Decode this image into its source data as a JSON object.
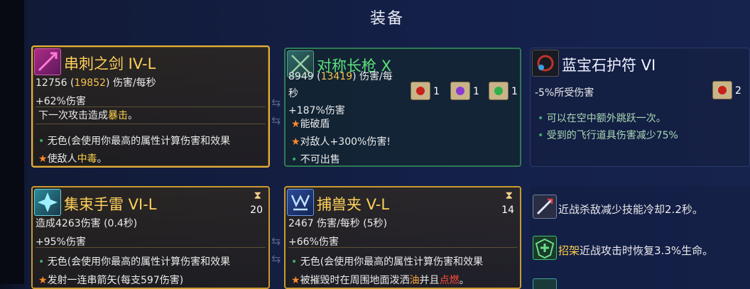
{
  "title": "装备",
  "cards": [
    {
      "name": "串刺之剑 IV-L",
      "dps": "12756",
      "dps_alt": "19852",
      "dps_unit": "伤害/每秒",
      "dmg_bonus": "+62%伤害",
      "effect_pre": "下一次攻击造成",
      "effect_hl": "暴击",
      "effect_post": "。",
      "bullet1": "无色(会使用你最高的属性计算伤害和效果",
      "bullet2_pre": "使敌人",
      "bullet2_hl": "中毒",
      "bullet2_post": "。"
    },
    {
      "name": "对称长枪 X",
      "dps": "8949",
      "dps_alt": "13419",
      "dps_unit1": "伤害/每",
      "dps_unit2": "秒",
      "dmg_bonus": "+187%伤害",
      "line1": "能破盾",
      "line2": "对敌人+300%伤害!",
      "line3": "不可出售",
      "scroll_counts": [
        "1",
        "1",
        "1"
      ]
    },
    {
      "name": "蓝宝石护符 VI",
      "line0": "-5%所受伤害",
      "scroll_count": "2",
      "line1": "可以在空中额外跳跃一次。",
      "line2": "受到的飞行道具伤害减少75%"
    },
    {
      "name": "集束手雷 VI-L",
      "cooldown": "20",
      "line0": "造成4263伤害 (0.4秒)",
      "dmg_bonus": "+95%伤害",
      "bullet1": "无色(会使用你最高的属性计算伤害和效果",
      "bullet2": "发射一连串箭矢(每支597伤害)"
    },
    {
      "name": "捕兽夹 V-L",
      "cooldown": "14",
      "line0": "2467 伤害/每秒 (5秒)",
      "dmg_bonus": "+66%伤害",
      "bullet1": "无色(会使用你最高的属性计算伤害和效果",
      "bullet2_pre": "被摧毁时在周围地面泼洒",
      "bullet2_oil": "油",
      "bullet2_mid": "并且",
      "bullet2_fire": "点燃",
      "bullet2_post": "。"
    }
  ],
  "skills": [
    {
      "text": "近战杀敌减少技能冷却2.2秒。"
    },
    {
      "text_hl": "招架",
      "text": "近战攻击时恢复3.3%生命。"
    }
  ]
}
